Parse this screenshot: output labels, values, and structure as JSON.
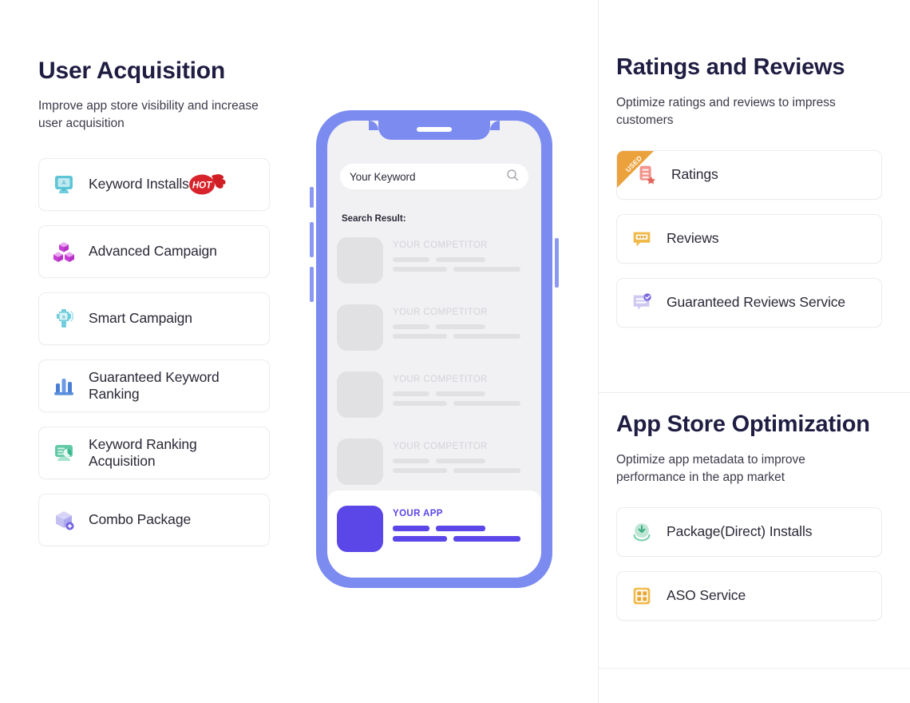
{
  "sections": {
    "user_acquisition": {
      "title": "User Acquisition",
      "subtitle": "Improve app store visibility and increase user acquisition",
      "items": [
        {
          "label": "Keyword Installs",
          "icon": "monitor-keyword-icon",
          "badge": "HOT"
        },
        {
          "label": "Advanced Campaign",
          "icon": "boxes-stack-icon"
        },
        {
          "label": "Smart Campaign",
          "icon": "smart-broadcast-icon"
        },
        {
          "label": "Guaranteed Keyword Ranking",
          "icon": "bar-chart-icon"
        },
        {
          "label": "Keyword Ranking Acquisition",
          "icon": "chart-screen-icon"
        },
        {
          "label": "Combo Package",
          "icon": "package-plus-icon"
        }
      ]
    },
    "ratings_and_reviews": {
      "title": "Ratings and Reviews",
      "subtitle": "Optimize ratings and reviews to impress customers",
      "items": [
        {
          "label": "Ratings",
          "icon": "ratings-star-icon",
          "ribbon": "USED"
        },
        {
          "label": "Reviews",
          "icon": "speech-bubble-icon"
        },
        {
          "label": "Guaranteed Reviews Service",
          "icon": "reviews-check-icon"
        }
      ]
    },
    "app_store_optimization": {
      "title": "App Store Optimization",
      "subtitle": "Optimize app metadata to improve performance in the app market",
      "items": [
        {
          "label": "Package(Direct) Installs",
          "icon": "download-circle-icon"
        },
        {
          "label": "ASO Service",
          "icon": "grid-squares-icon"
        }
      ]
    }
  },
  "phone": {
    "search_value": "Your Keyword",
    "search_icon": "search-icon",
    "result_heading": "Search Result:",
    "results": [
      {
        "title": "YOUR COMPETITOR",
        "mine": false
      },
      {
        "title": "YOUR COMPETITOR",
        "mine": false
      },
      {
        "title": "YOUR COMPETITOR",
        "mine": false
      },
      {
        "title": "YOUR COMPETITOR",
        "mine": false
      },
      {
        "title": "YOUR APP",
        "mine": true
      }
    ]
  },
  "colors": {
    "heading": "#1f1d42",
    "phone_frame": "#7b8bf0",
    "my_app_accent": "#5b46e8",
    "ribbon_orange": "#eca23c",
    "hot_red": "#d81f26",
    "card_border": "#ececf0"
  }
}
